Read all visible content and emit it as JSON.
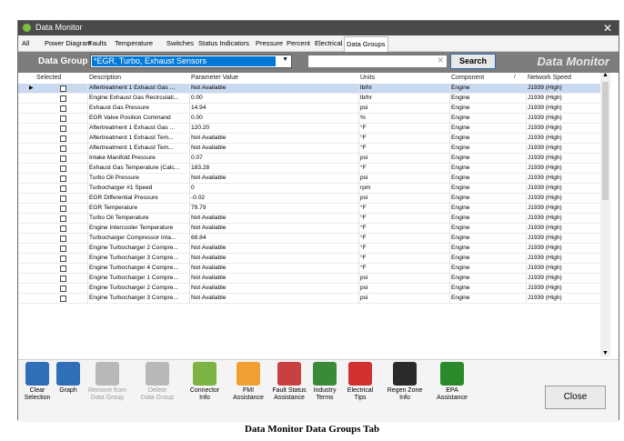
{
  "window": {
    "title": "Data Monitor",
    "close_glyph": "✕"
  },
  "tabs": [
    {
      "label": "All"
    },
    {
      "label": "Power Diagram"
    },
    {
      "label": "Faults"
    },
    {
      "label": "Temperature"
    },
    {
      "label": "Switches"
    },
    {
      "label": "Status Indicators"
    },
    {
      "label": "Pressure"
    },
    {
      "label": "Percent"
    },
    {
      "label": "Electrical"
    },
    {
      "label": "Data Groups"
    }
  ],
  "active_tab": "Data Groups",
  "data_group": {
    "label": "Data Group",
    "selected": "*EGR, Turbo, Exhaust Sensors",
    "search_value": "",
    "search_button": "Search",
    "brand": "Data Monitor"
  },
  "table": {
    "headers": [
      "Selected",
      "Description",
      "Parameter Value",
      "Units",
      "Component",
      "Network Speed"
    ],
    "rows": [
      {
        "desc": "Aftertreatment 1 Exhaust Gas ...",
        "value": "Not Available",
        "units": "lb/hr",
        "component": "Engine",
        "speed": "J1939 (High)"
      },
      {
        "desc": "Engine Exhaust Gas Recirculati...",
        "value": "0.00",
        "units": "lb/hr",
        "component": "Engine",
        "speed": "J1939 (High)"
      },
      {
        "desc": "Exhaust Gas Pressure",
        "value": "14.94",
        "units": "psi",
        "component": "Engine",
        "speed": "J1939 (High)"
      },
      {
        "desc": "EGR Valve Position Command",
        "value": "0.00",
        "units": "%",
        "component": "Engine",
        "speed": "J1939 (High)"
      },
      {
        "desc": "Aftertreatment 1 Exhaust Gas ...",
        "value": "120.20",
        "units": "°F",
        "component": "Engine",
        "speed": "J1939 (High)"
      },
      {
        "desc": "Aftertreatment 1 Exhaust Tem...",
        "value": "Not Available",
        "units": "°F",
        "component": "Engine",
        "speed": "J1939 (High)"
      },
      {
        "desc": "Aftertreatment 1 Exhaust Tem...",
        "value": "Not Available",
        "units": "°F",
        "component": "Engine",
        "speed": "J1939 (High)"
      },
      {
        "desc": "Intake Manifold Pressure",
        "value": "0.07",
        "units": "psi",
        "component": "Engine",
        "speed": "J1939 (High)"
      },
      {
        "desc": "Exhaust Gas Temperature (Calc...",
        "value": "183.28",
        "units": "°F",
        "component": "Engine",
        "speed": "J1939 (High)"
      },
      {
        "desc": "Turbo Oil Pressure",
        "value": "Not Available",
        "units": "psi",
        "component": "Engine",
        "speed": "J1939 (High)"
      },
      {
        "desc": "Turbocharger #1 Speed",
        "value": "0",
        "units": "rpm",
        "component": "Engine",
        "speed": "J1939 (High)"
      },
      {
        "desc": "EGR Differential Pressure",
        "value": "-0.02",
        "units": "psi",
        "component": "Engine",
        "speed": "J1939 (High)"
      },
      {
        "desc": "EGR Temperature",
        "value": "79.79",
        "units": "°F",
        "component": "Engine",
        "speed": "J1939 (High)"
      },
      {
        "desc": "Turbo Oil Temperature",
        "value": "Not Available",
        "units": "°F",
        "component": "Engine",
        "speed": "J1939 (High)"
      },
      {
        "desc": "Engine Intercooler Temperature",
        "value": "Not Available",
        "units": "°F",
        "component": "Engine",
        "speed": "J1939 (High)"
      },
      {
        "desc": "Turbocharger Compressor Inta...",
        "value": "68.84",
        "units": "°F",
        "component": "Engine",
        "speed": "J1939 (High)"
      },
      {
        "desc": "Engine Turbocharger 2 Compre...",
        "value": "Not Available",
        "units": "°F",
        "component": "Engine",
        "speed": "J1939 (High)"
      },
      {
        "desc": "Engine Turbocharger 3 Compre...",
        "value": "Not Available",
        "units": "°F",
        "component": "Engine",
        "speed": "J1939 (High)"
      },
      {
        "desc": "Engine Turbocharger 4 Compre...",
        "value": "Not Available",
        "units": "°F",
        "component": "Engine",
        "speed": "J1939 (High)"
      },
      {
        "desc": "Engine Turbocharger 1 Compre...",
        "value": "Not Available",
        "units": "psi",
        "component": "Engine",
        "speed": "J1939 (High)"
      },
      {
        "desc": "Engine Turbocharger 2 Compre...",
        "value": "Not Available",
        "units": "psi",
        "component": "Engine",
        "speed": "J1939 (High)"
      },
      {
        "desc": "Engine Turbocharger 3 Compre...",
        "value": "Not Available",
        "units": "psi",
        "component": "Engine",
        "speed": "J1939 (High)"
      }
    ]
  },
  "toolbar": [
    {
      "id": "clear-selection",
      "label": "Clear\nSelection",
      "icon": "clear-selection-icon",
      "color": "#2f6fb8",
      "enabled": true
    },
    {
      "id": "graph",
      "label": "Graph",
      "icon": "graph-icon",
      "color": "#2f6fb8",
      "enabled": true
    },
    {
      "id": "remove-from-data-group",
      "label": "Remove from\nData Group",
      "icon": "remove-icon",
      "color": "#b8b8b8",
      "enabled": false
    },
    {
      "id": "delete-data-group",
      "label": "Delete\nData Group",
      "icon": "delete-icon",
      "color": "#b8b8b8",
      "enabled": false
    },
    {
      "id": "connector-info",
      "label": "Connector\nInfo",
      "icon": "connector-icon",
      "color": "#7cb342",
      "enabled": true
    },
    {
      "id": "fmi-assistance",
      "label": "FMI\nAssistance",
      "icon": "fmi-icon",
      "color": "#f0a030",
      "enabled": true
    },
    {
      "id": "fault-status-assistance",
      "label": "Fault Status\nAssistance",
      "icon": "fault-status-icon",
      "color": "#c84040",
      "enabled": true
    },
    {
      "id": "industry-terms",
      "label": "Industry\nTerms",
      "icon": "industry-terms-icon",
      "color": "#3a8a3a",
      "enabled": true
    },
    {
      "id": "electrical-tips",
      "label": "Electrical\nTips",
      "icon": "electrical-tips-icon",
      "color": "#d03030",
      "enabled": true
    },
    {
      "id": "regen-zone-info",
      "label": "Regen Zone\nInfo",
      "icon": "regen-zone-icon",
      "color": "#2a2a2a",
      "enabled": true
    },
    {
      "id": "epa-assistance",
      "label": "EPA\nAssistance",
      "icon": "epa-icon",
      "color": "#2a8a2a",
      "enabled": true
    }
  ],
  "close_button": "Close",
  "caption": "Data Monitor Data Groups Tab"
}
